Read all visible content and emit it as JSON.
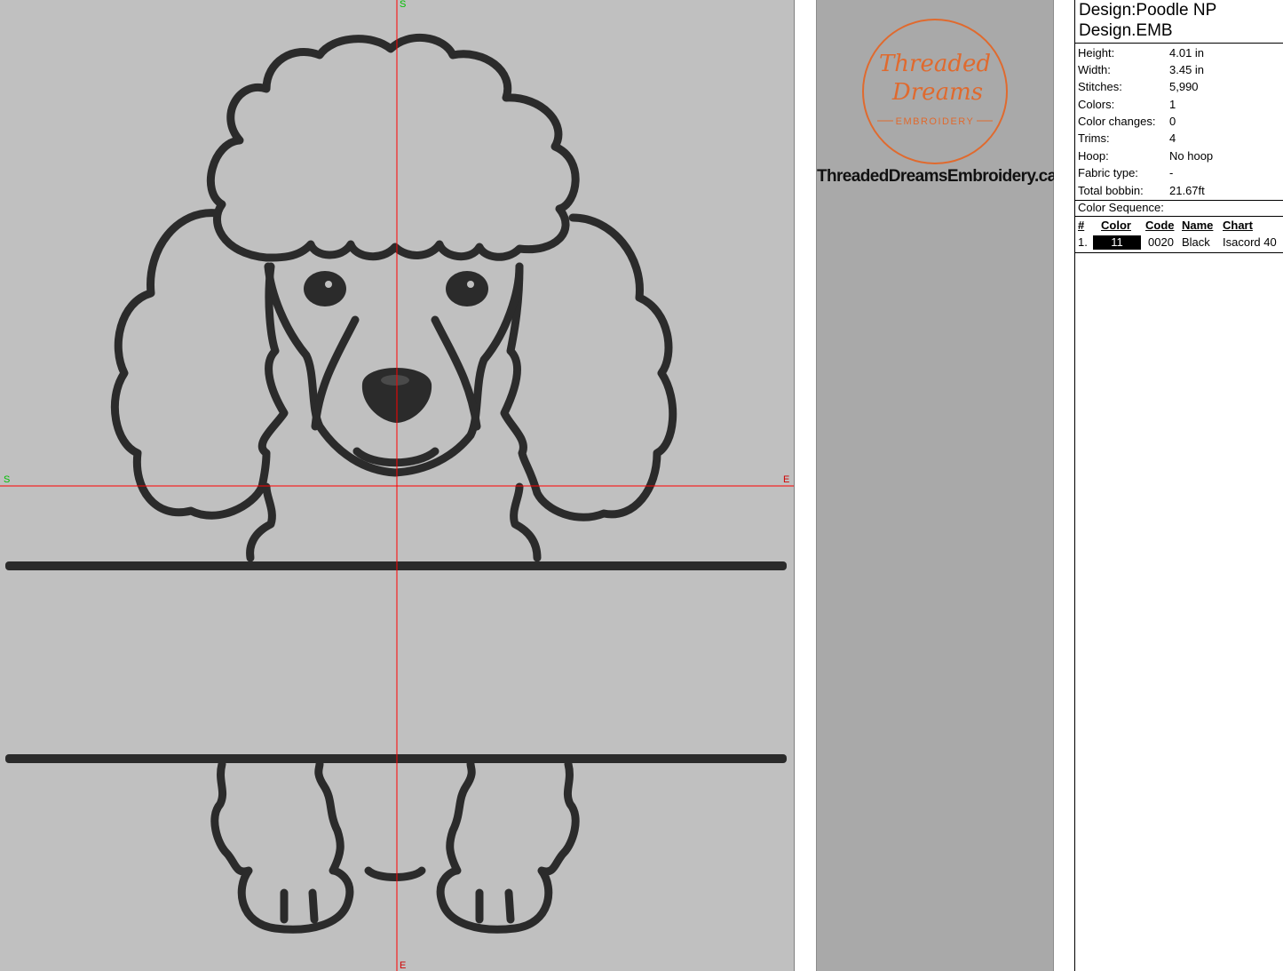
{
  "canvas": {
    "background": "#c0c0c0",
    "crosshair_color": "#ff0000",
    "stitch_color": "#2b2b2b",
    "markers": {
      "top": "S",
      "left": "S",
      "right": "E",
      "bottom": "E"
    },
    "marker_colors": {
      "start": "#00c000",
      "end": "#d00000"
    }
  },
  "brand": {
    "logo_line1": "Threaded",
    "logo_line2": "Dreams",
    "logo_sub": "EMBROIDERY",
    "logo_color": "#e06a2e",
    "website": "ThreadedDreamsEmbroidery.ca"
  },
  "info": {
    "title": "Design:Poodle NP",
    "filename": "Design.EMB",
    "properties": [
      {
        "label": "Height:",
        "value": "4.01 in"
      },
      {
        "label": "Width:",
        "value": "3.45 in"
      },
      {
        "label": "Stitches:",
        "value": "5,990"
      },
      {
        "label": "Colors:",
        "value": "1"
      },
      {
        "label": "Color changes:",
        "value": "0"
      },
      {
        "label": "Trims:",
        "value": "4"
      },
      {
        "label": "Hoop:",
        "value": "No hoop"
      },
      {
        "label": "Fabric type:",
        "value": "-"
      },
      {
        "label": "Total bobbin:",
        "value": "21.67ft"
      }
    ],
    "sequence_title": "Color Sequence:",
    "sequence_headers": {
      "num": "#",
      "color": "Color",
      "code": "Code",
      "name": "Name",
      "chart": "Chart"
    },
    "sequence": [
      {
        "num": "1.",
        "swatch_label": "11",
        "swatch_color": "#000000",
        "code": "0020",
        "name": "Black",
        "chart": "Isacord 40"
      }
    ]
  }
}
